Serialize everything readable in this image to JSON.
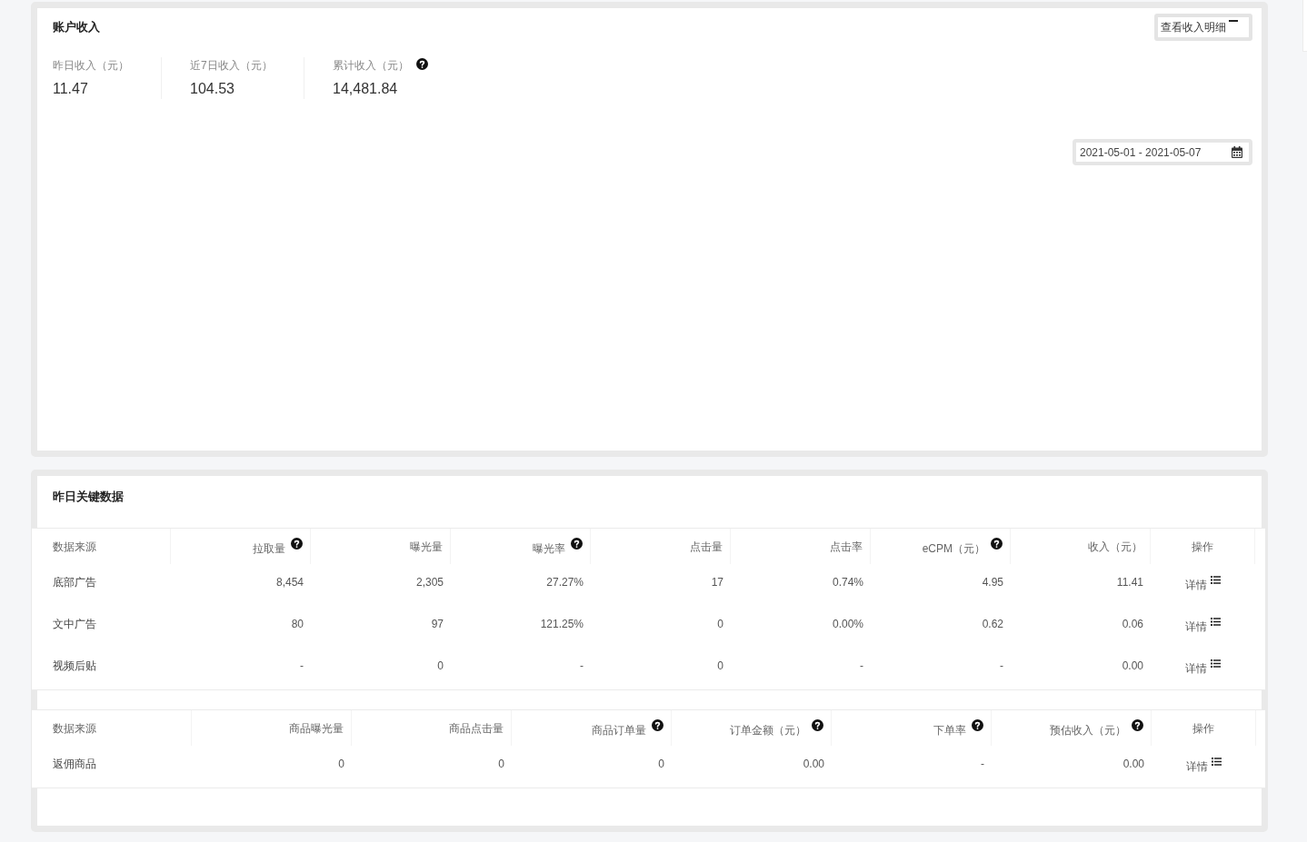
{
  "account_income": {
    "title": "账户收入",
    "details_button": "查看收入明细",
    "stats": [
      {
        "label": "昨日收入（元）",
        "value": "11.47",
        "help": false
      },
      {
        "label": "近7日收入（元）",
        "value": "104.53",
        "help": false
      },
      {
        "label": "累计收入（元）",
        "value": "14,481.84",
        "help": true
      }
    ],
    "date_range": "2021-05-01 - 2021-05-07"
  },
  "key_data": {
    "title": "昨日关键数据",
    "ad_table": {
      "columns": [
        {
          "label": "数据来源",
          "help": false
        },
        {
          "label": "拉取量",
          "help": true
        },
        {
          "label": "曝光量",
          "help": false
        },
        {
          "label": "曝光率",
          "help": true
        },
        {
          "label": "点击量",
          "help": false
        },
        {
          "label": "点击率",
          "help": false
        },
        {
          "label": "eCPM（元）",
          "help": true
        },
        {
          "label": "收入（元）",
          "help": false
        },
        {
          "label": "操作",
          "help": false
        }
      ],
      "rows": [
        {
          "cells": [
            "底部广告",
            "8,454",
            "2,305",
            "27.27%",
            "17",
            "0.74%",
            "4.95",
            "11.41"
          ],
          "action": "详情"
        },
        {
          "cells": [
            "文中广告",
            "80",
            "97",
            "121.25%",
            "0",
            "0.00%",
            "0.62",
            "0.06"
          ],
          "action": "详情"
        },
        {
          "cells": [
            "视频后贴",
            "-",
            "0",
            "-",
            "0",
            "-",
            "-",
            "0.00"
          ],
          "action": "详情"
        }
      ]
    },
    "product_table": {
      "columns": [
        {
          "label": "数据来源",
          "help": false
        },
        {
          "label": "商品曝光量",
          "help": false
        },
        {
          "label": "商品点击量",
          "help": false
        },
        {
          "label": "商品订单量",
          "help": true
        },
        {
          "label": "订单金额（元）",
          "help": true
        },
        {
          "label": "下单率",
          "help": true
        },
        {
          "label": "预估收入（元）",
          "help": true
        },
        {
          "label": "操作",
          "help": false
        }
      ],
      "rows": [
        {
          "cells": [
            "返佣商品",
            "0",
            "0",
            "0",
            "0.00",
            "-",
            "0.00"
          ],
          "action": "详情"
        }
      ]
    }
  }
}
